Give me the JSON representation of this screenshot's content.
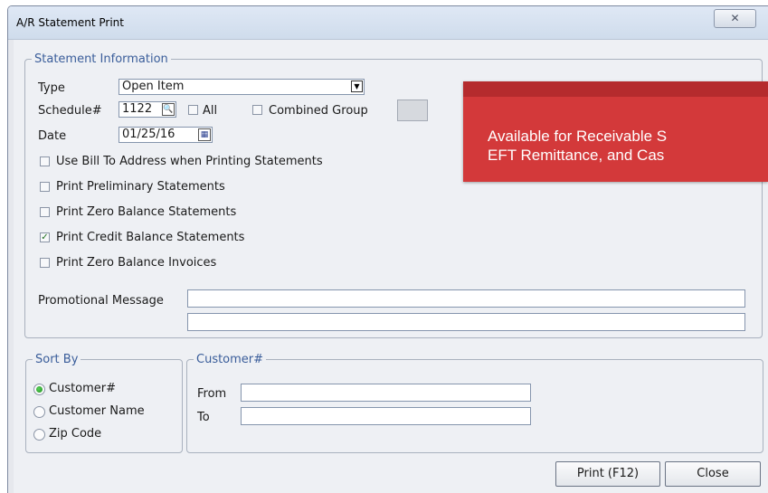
{
  "window": {
    "title": "A/R Statement Print",
    "close_glyph": "✕"
  },
  "statement_info": {
    "legend": "Statement Information",
    "type_label": "Type",
    "type_value": "Open Item",
    "type_dropdown_glyph": "▼",
    "schedule_label": "Schedule#",
    "schedule_value": "1122",
    "lookup_glyph": "🔍",
    "all_label": "All",
    "all_checked": false,
    "combined_group_label": "Combined Group",
    "combined_group_checked": false,
    "date_label": "Date",
    "date_value": "01/25/16",
    "calendar_glyph": "▦",
    "options": [
      {
        "label": "Use Bill To Address when Printing Statements",
        "checked": false
      },
      {
        "label": "Print Preliminary Statements",
        "checked": false
      },
      {
        "label": "Print Zero Balance Statements",
        "checked": false
      },
      {
        "label": "Print Credit Balance Statements",
        "checked": true
      },
      {
        "label": "Print Zero Balance Invoices",
        "checked": false
      }
    ],
    "check_glyph": "✓",
    "promo_label": "Promotional Message",
    "promo_line1": "",
    "promo_line2": ""
  },
  "sort_by": {
    "legend": "Sort By",
    "options": [
      {
        "label": "Customer#",
        "selected": true
      },
      {
        "label": "Customer Name",
        "selected": false
      },
      {
        "label": "Zip Code",
        "selected": false
      }
    ]
  },
  "customer_range": {
    "legend": "Customer#",
    "from_label": "From",
    "from_value": "",
    "to_label": "To",
    "to_value": ""
  },
  "buttons": {
    "print": "Print (F12)",
    "close": "Close"
  },
  "callout": {
    "line1": "Available for Receivable S",
    "line2": "EFT Remittance, and Cas",
    "background": "#d3393a",
    "band": "#b52b2d"
  },
  "colors": {
    "legend_text": "#3a5d9a",
    "radio_selected": "#1e8c1e"
  }
}
